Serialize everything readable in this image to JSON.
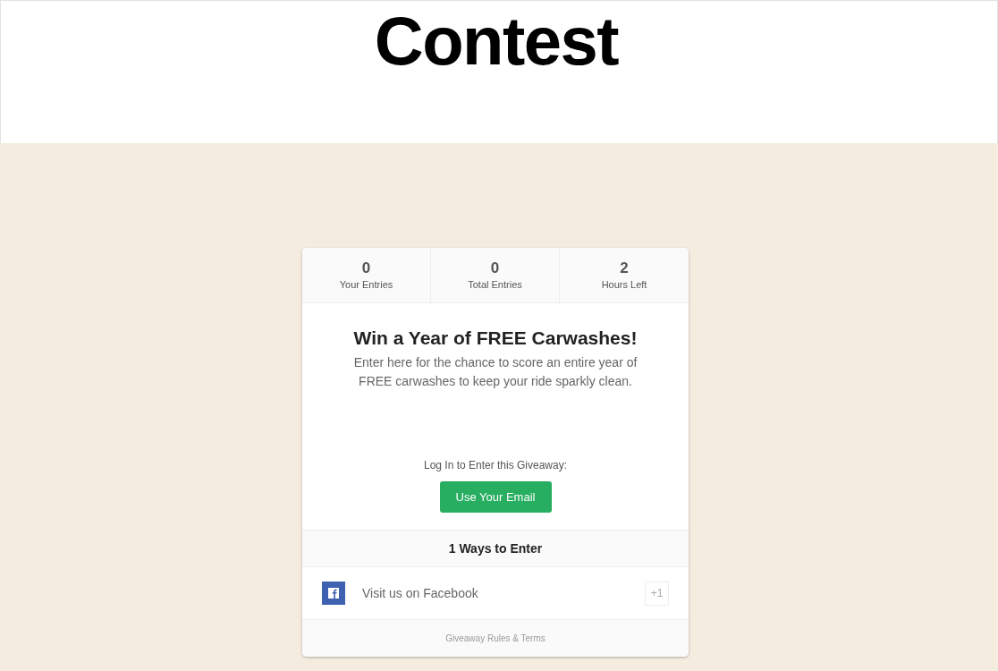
{
  "page": {
    "heading": "Contest"
  },
  "giveaway": {
    "stats": [
      {
        "value": "0",
        "label": "Your Entries"
      },
      {
        "value": "0",
        "label": "Total Entries"
      },
      {
        "value": "2",
        "label": "Hours Left"
      }
    ],
    "title": "Win a Year of FREE Carwashes!",
    "description": "Enter here for the chance to score an entire year of FREE carwashes to keep your ride sparkly clean.",
    "login_prompt": "Log In to Enter this Giveaway:",
    "login_button": "Use Your Email",
    "ways_heading": "1 Ways to Enter",
    "entries": [
      {
        "kind": "facebook",
        "label": "Visit us on Facebook",
        "points": "+1"
      }
    ],
    "footer_link": "Giveaway Rules & Terms"
  }
}
